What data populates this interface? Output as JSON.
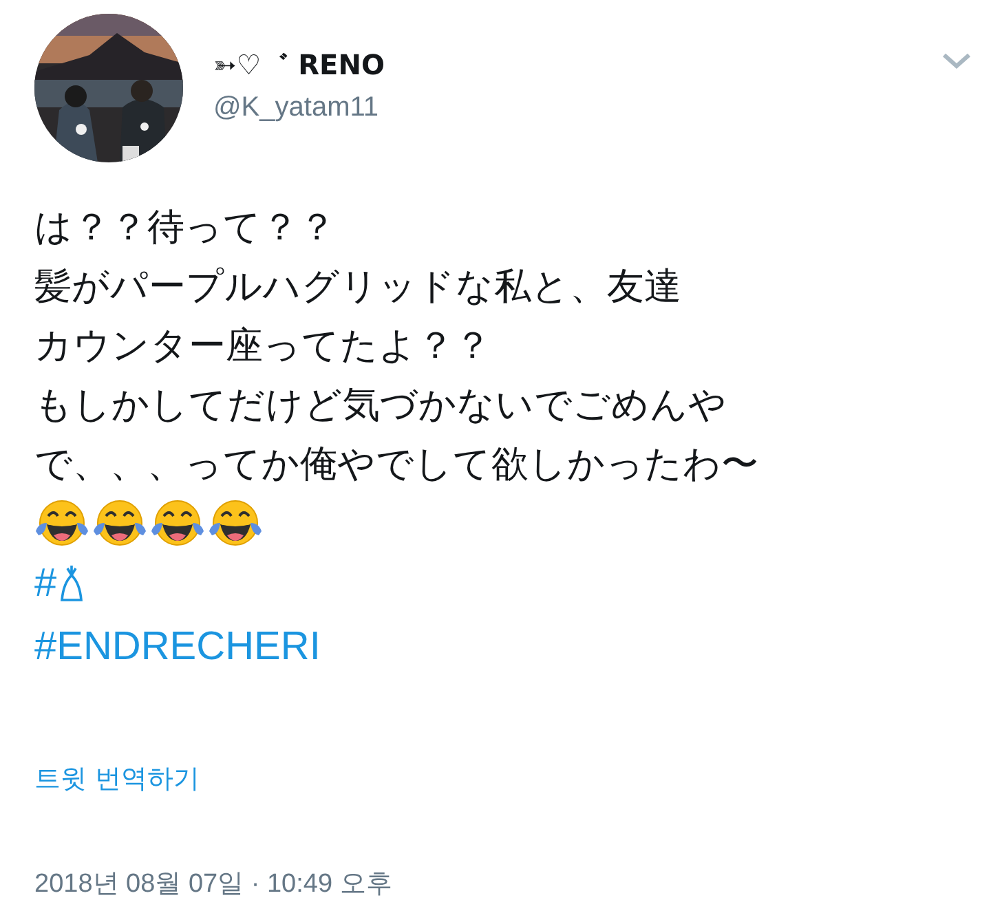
{
  "author": {
    "name": "➳♡゛ RENO",
    "handle": "@K_yatam11"
  },
  "tweet": {
    "lines": [
      "は？？待って？？",
      "髪がパープルハグリッドな私と、友達",
      "カウンター座ってたよ？？",
      "もしかしてだけど気づかないでごめんや",
      "で、、、ってか俺やでして欲しかったわ〜"
    ],
    "hashtags": [
      {
        "prefix": "#",
        "kind": "symbol"
      },
      {
        "prefix": "#ENDRECHERI",
        "kind": "text"
      }
    ],
    "translate": "트윗 번역하기",
    "timestamp": "2018년 08월 07일 · 10:49 오후"
  }
}
